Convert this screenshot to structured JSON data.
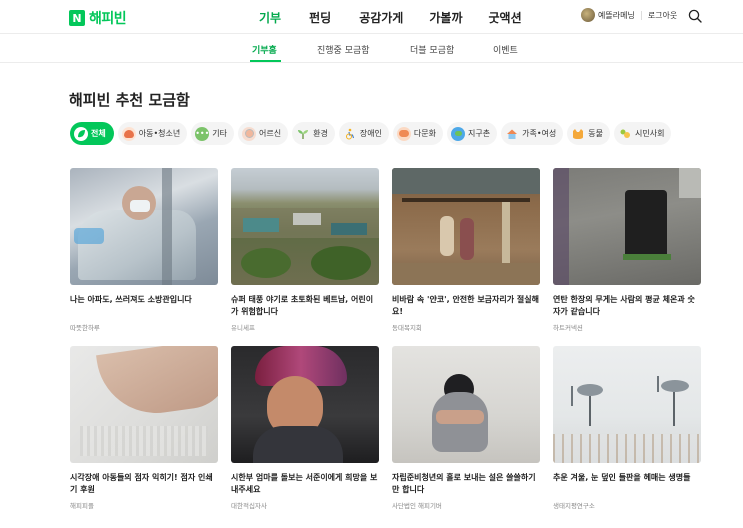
{
  "logo": {
    "mark": "N",
    "name": "해피빈"
  },
  "gnb": [
    "기부",
    "펀딩",
    "공감가게",
    "가볼까",
    "굿액션"
  ],
  "user": {
    "name": "예뜰라메닝",
    "logout": "로그아웃"
  },
  "subnav": [
    "기부홈",
    "진행중 모금함",
    "더블 모금함",
    "이벤트"
  ],
  "section_title": "해피빈 추천 모금함",
  "categories": [
    {
      "label": "전체",
      "icon": "leaf-icon",
      "color": "#ffffff"
    },
    {
      "label": "아동•청소년",
      "icon": "child-icon",
      "color": "#f6c3a4"
    },
    {
      "label": "기타",
      "icon": "dots-icon",
      "color": "#7cc36a"
    },
    {
      "label": "어르신",
      "icon": "elder-icon",
      "color": "#f2d0c2"
    },
    {
      "label": "환경",
      "icon": "sprout-icon",
      "color": "#7cc36a"
    },
    {
      "label": "장애인",
      "icon": "wheelchair-icon",
      "color": "#f5c44a"
    },
    {
      "label": "다문화",
      "icon": "multicultural-icon",
      "color": "#f08d5e"
    },
    {
      "label": "지구촌",
      "icon": "globe-icon",
      "color": "#4da8e8"
    },
    {
      "label": "가족•여성",
      "icon": "house-icon",
      "color": "#f08d5e"
    },
    {
      "label": "동물",
      "icon": "cat-icon",
      "color": "#f4a83a"
    },
    {
      "label": "시민사회",
      "icon": "community-icon",
      "color": "#9bc83e"
    }
  ],
  "cards": [
    {
      "title": "나는 아파도, 쓰러져도 소방관입니다",
      "org": "따뜻한하루"
    },
    {
      "title": "슈퍼 태풍 야기로 초토화된 베트남, 어린이가 위험합니다",
      "org": "유니세프"
    },
    {
      "title": "비바람 속 '얀코', 안전한 보금자리가 절실해요!",
      "org": "동대복지회"
    },
    {
      "title": "연탄 한장의 무게는 사람의 평균 체온과 숫자가 같습니다",
      "org": "하트커넥션"
    },
    {
      "title": "시각장애 아동들의 점자 익히기! 점자 인쇄기 후원",
      "org": "해피피플"
    },
    {
      "title": "시한부 엄마를 돌보는 서준이에게 희망을 보내주세요",
      "org": "대한적십자사"
    },
    {
      "title": "자립준비청년의 홀로 보내는 설은 쓸쓸하기만 합니다",
      "org": "사단법인 해피기버"
    },
    {
      "title": "추운 겨울, 눈 덮인 들판을 헤매는 생명들",
      "org": "생태지평연구소"
    }
  ]
}
